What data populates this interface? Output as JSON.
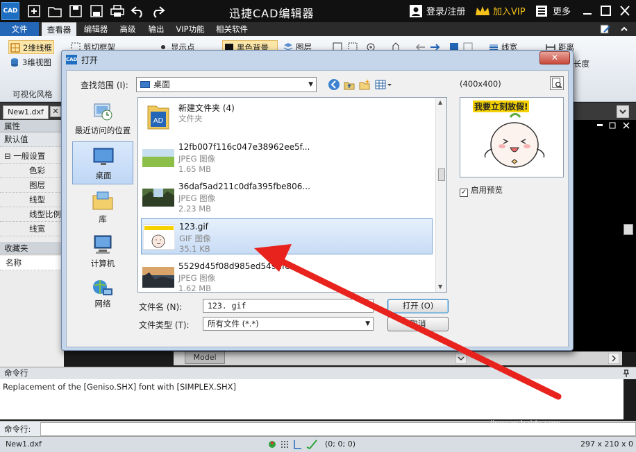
{
  "app": {
    "icon_text": "CAD",
    "title": "迅捷CAD编辑器",
    "login_label": "登录/注册",
    "vip_label": "加入VIP",
    "more_label": "更多"
  },
  "menu": {
    "tabs": [
      "文件",
      "查看器",
      "编辑器",
      "高级",
      "输出",
      "VIP功能",
      "相关软件"
    ]
  },
  "ribbon": {
    "buttons": [
      "2维线框",
      "3维视图",
      "剪切框架",
      "显示点",
      "黑色背景",
      "图层",
      "线宽",
      "距离",
      "长度"
    ],
    "group_labels": [
      "可视化风格"
    ]
  },
  "document": {
    "tab_label": "New1.dxf",
    "close_glyph": "✕"
  },
  "properties": {
    "header": "属性",
    "default_label": "默认值",
    "section": "⊟ 一般设置",
    "rows": [
      "色彩",
      "图层",
      "线型",
      "线型比例",
      "线宽"
    ],
    "favorites_header": "收藏夹",
    "name_label": "名称"
  },
  "model_tab": "Model",
  "command": {
    "header": "命令行",
    "log": "Replacement of the [Geniso.SHX] font with [SIMPLEX.SHX]",
    "input_label": "命令行:"
  },
  "status": {
    "file": "New1.dxf",
    "coords": "(0; 0; 0)",
    "paper": "297 x 210 x 0"
  },
  "dialog": {
    "title": "打开",
    "close_glyph": "✕",
    "look_in_label": "查找范围 (I):",
    "look_in_value": "桌面",
    "places": [
      {
        "label": "最近访问的位置",
        "icon": "recent-icon"
      },
      {
        "label": "桌面",
        "icon": "desktop-icon"
      },
      {
        "label": "库",
        "icon": "library-icon"
      },
      {
        "label": "计算机",
        "icon": "computer-icon"
      },
      {
        "label": "网络",
        "icon": "network-icon"
      }
    ],
    "files": [
      {
        "name": "新建文件夹 (4)",
        "type": "文件夹",
        "size": ""
      },
      {
        "name": "12fb007f116c047e38962ee5f...",
        "type": "JPEG 图像",
        "size": "1.65 MB"
      },
      {
        "name": "36daf5ad211c0dfa395fbe806...",
        "type": "JPEG 图像",
        "size": "2.23 MB"
      },
      {
        "name": "123.gif",
        "type": "GIF 图像",
        "size": "35.1 KB"
      },
      {
        "name": "5529d45f08d985ed5491fc...",
        "type": "JPEG 图像",
        "size": "1.62 MB"
      }
    ],
    "preview_size": "(400x400)",
    "preview_caption": "我要立刻放假!",
    "enable_preview_label": "启用预览",
    "filename_label": "文件名 (N):",
    "filename_value": "123. gif",
    "filetype_label": "文件类型 (T):",
    "filetype_value": "所有文件  (*.*)",
    "open_label": "打开 (O)",
    "cancel_label": "取消"
  },
  "watermark": {
    "brand": "Baidu 经验",
    "url": "jingyan.baidu.com"
  },
  "colors": {
    "accent": "#2366b7",
    "arrow": "#e8231d"
  }
}
